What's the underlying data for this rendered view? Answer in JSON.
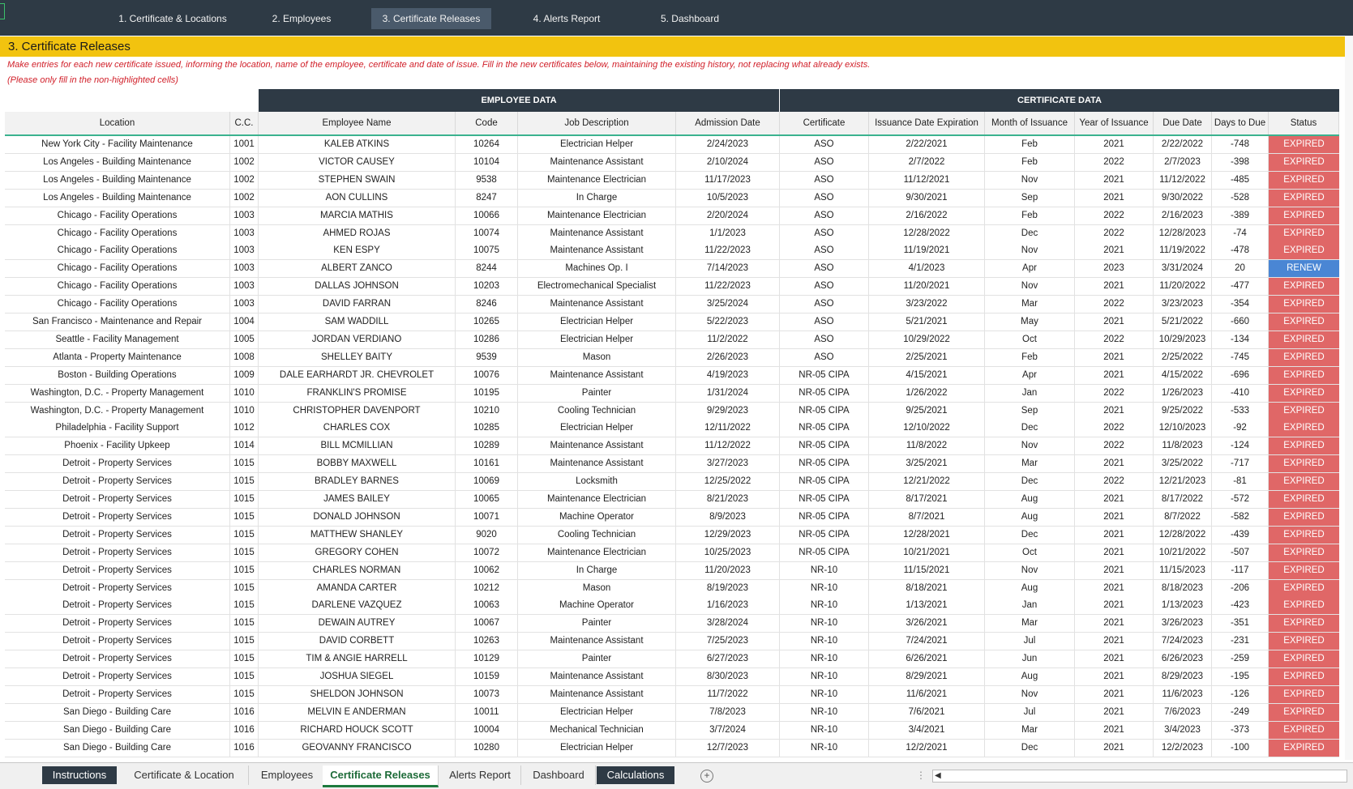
{
  "nav": {
    "tabs": [
      {
        "label": "1. Certificate & Locations"
      },
      {
        "label": "2. Employees"
      },
      {
        "label": "3. Certificate Releases"
      },
      {
        "label": "4. Alerts Report"
      },
      {
        "label": "5. Dashboard"
      }
    ],
    "active_index": 2
  },
  "page": {
    "title": "3. Certificate Releases",
    "instruction_1": "Make entries for each new certificate issued, informing the location, name of the employee, certificate and date of issue. Fill in the new certificates below, maintaining the existing history, not replacing what already exists.",
    "instruction_2": "(Please only fill in the non-highlighted cells)"
  },
  "groups": {
    "employee": "EMPLOYEE DATA",
    "certificate": "CERTIFICATE DATA"
  },
  "columns": [
    "Location",
    "C.C.",
    "Employee Name",
    "Code",
    "Job Description",
    "Admission Date",
    "Certificate",
    "Issuance Date Expiration",
    "Month of Issuance",
    "Year of Issuance",
    "Due Date",
    "Days to Due",
    "Status"
  ],
  "colors": {
    "expired": "#e06767",
    "renew": "#4a86d4",
    "header": "#2e3a45",
    "title_bar": "#f2c30f",
    "accent": "#3bb28f"
  },
  "rows": [
    [
      "New York City - Facility Maintenance",
      "1001",
      "KALEB ATKINS",
      "10264",
      "Electrician Helper",
      "2/24/2023",
      "ASO",
      "2/22/2021",
      "Feb",
      "2021",
      "2/22/2022",
      "-748",
      "EXPIRED"
    ],
    [
      "Los Angeles - Building Maintenance",
      "1002",
      "VICTOR CAUSEY",
      "10104",
      "Maintenance Assistant",
      "2/10/2024",
      "ASO",
      "2/7/2022",
      "Feb",
      "2022",
      "2/7/2023",
      "-398",
      "EXPIRED"
    ],
    [
      "Los Angeles - Building Maintenance",
      "1002",
      "STEPHEN SWAIN",
      "9538",
      "Maintenance Electrician",
      "11/17/2023",
      "ASO",
      "11/12/2021",
      "Nov",
      "2021",
      "11/12/2022",
      "-485",
      "EXPIRED"
    ],
    [
      "Los Angeles - Building Maintenance",
      "1002",
      "AON CULLINS",
      "8247",
      "In Charge",
      "10/5/2023",
      "ASO",
      "9/30/2021",
      "Sep",
      "2021",
      "9/30/2022",
      "-528",
      "EXPIRED"
    ],
    [
      "Chicago - Facility Operations",
      "1003",
      "MARCIA MATHIS",
      "10066",
      "Maintenance Electrician",
      "2/20/2024",
      "ASO",
      "2/16/2022",
      "Feb",
      "2022",
      "2/16/2023",
      "-389",
      "EXPIRED"
    ],
    [
      "Chicago - Facility Operations",
      "1003",
      "AHMED ROJAS",
      "10074",
      "Maintenance Assistant",
      "1/1/2023",
      "ASO",
      "12/28/2022",
      "Dec",
      "2022",
      "12/28/2023",
      "-74",
      "EXPIRED"
    ],
    [
      "Chicago - Facility Operations",
      "1003",
      "KEN ESPY",
      "10075",
      "Maintenance Assistant",
      "11/22/2023",
      "ASO",
      "11/19/2021",
      "Nov",
      "2021",
      "11/19/2022",
      "-478",
      "EXPIRED"
    ],
    [
      "Chicago - Facility Operations",
      "1003",
      "ALBERT ZANCO",
      "8244",
      "Machines Op. I",
      "7/14/2023",
      "ASO",
      "4/1/2023",
      "Apr",
      "2023",
      "3/31/2024",
      "20",
      "RENEW"
    ],
    [
      "Chicago - Facility Operations",
      "1003",
      "DALLAS JOHNSON",
      "10203",
      "Electromechanical Specialist",
      "11/22/2023",
      "ASO",
      "11/20/2021",
      "Nov",
      "2021",
      "11/20/2022",
      "-477",
      "EXPIRED"
    ],
    [
      "Chicago - Facility Operations",
      "1003",
      "DAVID FARRAN",
      "8246",
      "Maintenance Assistant",
      "3/25/2024",
      "ASO",
      "3/23/2022",
      "Mar",
      "2022",
      "3/23/2023",
      "-354",
      "EXPIRED"
    ],
    [
      "San Francisco - Maintenance and Repair",
      "1004",
      "SAM WADDILL",
      "10265",
      "Electrician Helper",
      "5/22/2023",
      "ASO",
      "5/21/2021",
      "May",
      "2021",
      "5/21/2022",
      "-660",
      "EXPIRED"
    ],
    [
      "Seattle - Facility Management",
      "1005",
      "JORDAN VERDIANO",
      "10286",
      "Electrician Helper",
      "11/2/2022",
      "ASO",
      "10/29/2022",
      "Oct",
      "2022",
      "10/29/2023",
      "-134",
      "EXPIRED"
    ],
    [
      "Atlanta - Property Maintenance",
      "1008",
      "SHELLEY BAITY",
      "9539",
      "Mason",
      "2/26/2023",
      "ASO",
      "2/25/2021",
      "Feb",
      "2021",
      "2/25/2022",
      "-745",
      "EXPIRED"
    ],
    [
      "Boston - Building Operations",
      "1009",
      "DALE EARHARDT JR. CHEVROLET",
      "10076",
      "Maintenance Assistant",
      "4/19/2023",
      "NR-05 CIPA",
      "4/15/2021",
      "Apr",
      "2021",
      "4/15/2022",
      "-696",
      "EXPIRED"
    ],
    [
      "Washington, D.C. - Property Management",
      "1010",
      "FRANKLIN'S PROMISE",
      "10195",
      "Painter",
      "1/31/2024",
      "NR-05 CIPA",
      "1/26/2022",
      "Jan",
      "2022",
      "1/26/2023",
      "-410",
      "EXPIRED"
    ],
    [
      "Washington, D.C. - Property Management",
      "1010",
      "CHRISTOPHER DAVENPORT",
      "10210",
      "Cooling Technician",
      "9/29/2023",
      "NR-05 CIPA",
      "9/25/2021",
      "Sep",
      "2021",
      "9/25/2022",
      "-533",
      "EXPIRED"
    ],
    [
      "Philadelphia - Facility Support",
      "1012",
      "CHARLES COX",
      "10285",
      "Electrician Helper",
      "12/11/2022",
      "NR-05 CIPA",
      "12/10/2022",
      "Dec",
      "2022",
      "12/10/2023",
      "-92",
      "EXPIRED"
    ],
    [
      "Phoenix - Facility Upkeep",
      "1014",
      "BILL MCMILLIAN",
      "10289",
      "Maintenance Assistant",
      "11/12/2022",
      "NR-05 CIPA",
      "11/8/2022",
      "Nov",
      "2022",
      "11/8/2023",
      "-124",
      "EXPIRED"
    ],
    [
      "Detroit - Property Services",
      "1015",
      "BOBBY MAXWELL",
      "10161",
      "Maintenance Assistant",
      "3/27/2023",
      "NR-05 CIPA",
      "3/25/2021",
      "Mar",
      "2021",
      "3/25/2022",
      "-717",
      "EXPIRED"
    ],
    [
      "Detroit - Property Services",
      "1015",
      "BRADLEY BARNES",
      "10069",
      "Locksmith",
      "12/25/2022",
      "NR-05 CIPA",
      "12/21/2022",
      "Dec",
      "2022",
      "12/21/2023",
      "-81",
      "EXPIRED"
    ],
    [
      "Detroit - Property Services",
      "1015",
      "JAMES BAILEY",
      "10065",
      "Maintenance Electrician",
      "8/21/2023",
      "NR-05 CIPA",
      "8/17/2021",
      "Aug",
      "2021",
      "8/17/2022",
      "-572",
      "EXPIRED"
    ],
    [
      "Detroit - Property Services",
      "1015",
      "DONALD JOHNSON",
      "10071",
      "Machine Operator",
      "8/9/2023",
      "NR-05 CIPA",
      "8/7/2021",
      "Aug",
      "2021",
      "8/7/2022",
      "-582",
      "EXPIRED"
    ],
    [
      "Detroit - Property Services",
      "1015",
      "MATTHEW SHANLEY",
      "9020",
      "Cooling Technician",
      "12/29/2023",
      "NR-05 CIPA",
      "12/28/2021",
      "Dec",
      "2021",
      "12/28/2022",
      "-439",
      "EXPIRED"
    ],
    [
      "Detroit - Property Services",
      "1015",
      "GREGORY COHEN",
      "10072",
      "Maintenance Electrician",
      "10/25/2023",
      "NR-05 CIPA",
      "10/21/2021",
      "Oct",
      "2021",
      "10/21/2022",
      "-507",
      "EXPIRED"
    ],
    [
      "Detroit - Property Services",
      "1015",
      "CHARLES NORMAN",
      "10062",
      "In Charge",
      "11/20/2023",
      "NR-10",
      "11/15/2021",
      "Nov",
      "2021",
      "11/15/2023",
      "-117",
      "EXPIRED"
    ],
    [
      "Detroit - Property Services",
      "1015",
      "AMANDA CARTER",
      "10212",
      "Mason",
      "8/19/2023",
      "NR-10",
      "8/18/2021",
      "Aug",
      "2021",
      "8/18/2023",
      "-206",
      "EXPIRED"
    ],
    [
      "Detroit - Property Services",
      "1015",
      "DARLENE VAZQUEZ",
      "10063",
      "Machine Operator",
      "1/16/2023",
      "NR-10",
      "1/13/2021",
      "Jan",
      "2021",
      "1/13/2023",
      "-423",
      "EXPIRED"
    ],
    [
      "Detroit - Property Services",
      "1015",
      "DEWAIN AUTREY",
      "10067",
      "Painter",
      "3/28/2024",
      "NR-10",
      "3/26/2021",
      "Mar",
      "2021",
      "3/26/2023",
      "-351",
      "EXPIRED"
    ],
    [
      "Detroit - Property Services",
      "1015",
      "DAVID CORBETT",
      "10263",
      "Maintenance Assistant",
      "7/25/2023",
      "NR-10",
      "7/24/2021",
      "Jul",
      "2021",
      "7/24/2023",
      "-231",
      "EXPIRED"
    ],
    [
      "Detroit - Property Services",
      "1015",
      "TIM & ANGIE HARRELL",
      "10129",
      "Painter",
      "6/27/2023",
      "NR-10",
      "6/26/2021",
      "Jun",
      "2021",
      "6/26/2023",
      "-259",
      "EXPIRED"
    ],
    [
      "Detroit - Property Services",
      "1015",
      "JOSHUA SIEGEL",
      "10159",
      "Maintenance Assistant",
      "8/30/2023",
      "NR-10",
      "8/29/2021",
      "Aug",
      "2021",
      "8/29/2023",
      "-195",
      "EXPIRED"
    ],
    [
      "Detroit - Property Services",
      "1015",
      "SHELDON JOHNSON",
      "10073",
      "Maintenance Assistant",
      "11/7/2022",
      "NR-10",
      "11/6/2021",
      "Nov",
      "2021",
      "11/6/2023",
      "-126",
      "EXPIRED"
    ],
    [
      "San Diego - Building Care",
      "1016",
      "MELVIN E ANDERMAN",
      "10011",
      "Electrician Helper",
      "7/8/2023",
      "NR-10",
      "7/6/2021",
      "Jul",
      "2021",
      "7/6/2023",
      "-249",
      "EXPIRED"
    ],
    [
      "San Diego - Building Care",
      "1016",
      "RICHARD HOUCK SCOTT",
      "10004",
      "Mechanical Technician",
      "3/7/2024",
      "NR-10",
      "3/4/2021",
      "Mar",
      "2021",
      "3/4/2023",
      "-373",
      "EXPIRED"
    ],
    [
      "San Diego - Building Care",
      "1016",
      "GEOVANNY FRANCISCO",
      "10280",
      "Electrician Helper",
      "12/7/2023",
      "NR-10",
      "12/2/2021",
      "Dec",
      "2021",
      "12/2/2023",
      "-100",
      "EXPIRED"
    ]
  ],
  "sheet_tabs": [
    {
      "label": "Instructions",
      "style": "dark"
    },
    {
      "label": "Certificate & Location",
      "style": "normal"
    },
    {
      "label": "Employees",
      "style": "normal"
    },
    {
      "label": "Certificate Releases",
      "style": "active"
    },
    {
      "label": "Alerts Report",
      "style": "normal"
    },
    {
      "label": "Dashboard",
      "style": "normal"
    },
    {
      "label": "Calculations",
      "style": "dark"
    }
  ]
}
